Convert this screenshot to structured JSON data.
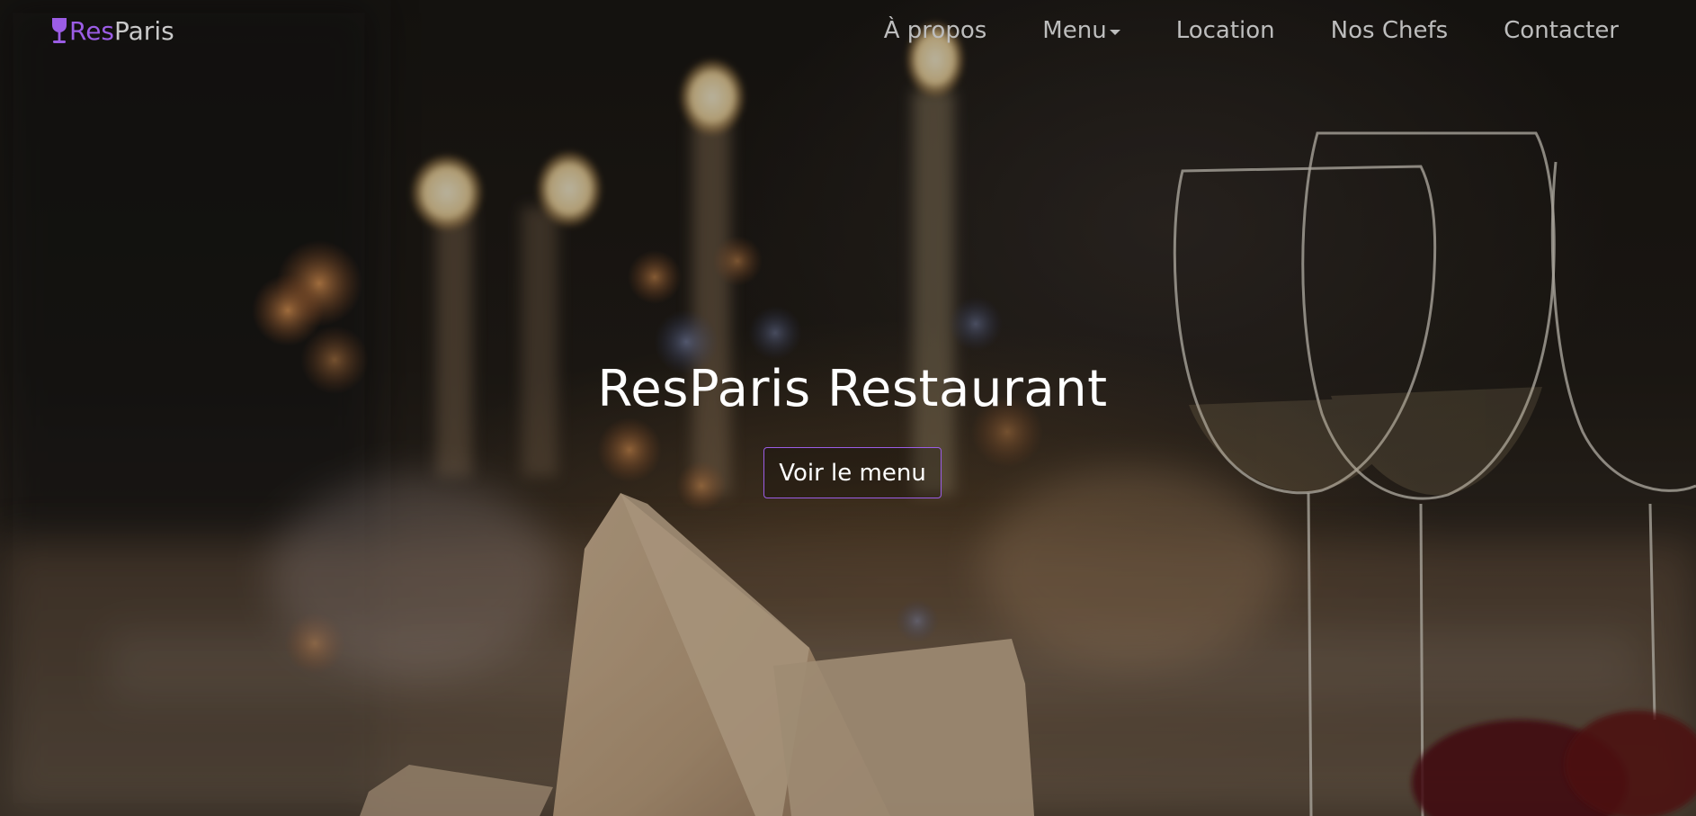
{
  "brand": {
    "part1": "Res",
    "part2": "Paris",
    "icon": "wine-glass-icon",
    "accent_color": "#9b5de5"
  },
  "nav": {
    "items": [
      {
        "label": "À propos"
      },
      {
        "label": "Menu",
        "has_dropdown": true
      },
      {
        "label": "Location"
      },
      {
        "label": "Nos Chefs"
      },
      {
        "label": "Contacter"
      }
    ]
  },
  "hero": {
    "title": "ResParis Restaurant",
    "cta_label": "Voir le menu"
  }
}
